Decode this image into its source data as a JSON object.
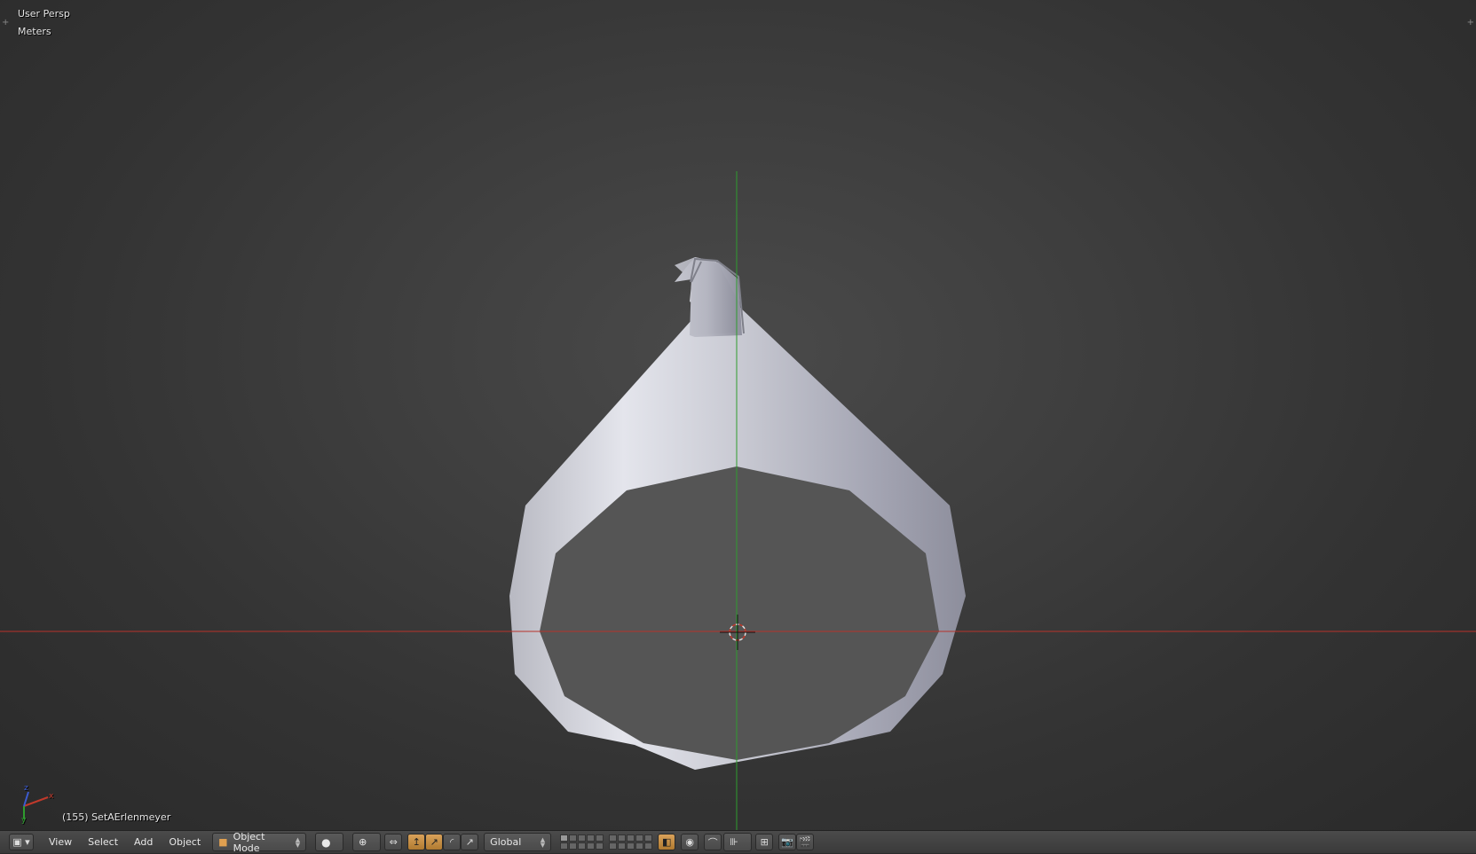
{
  "viewport": {
    "view_label": "User Persp",
    "units_label": "Meters",
    "object_info": "(155) SetAErlenmeyer"
  },
  "axes_gizmo": {
    "x": "x",
    "y": "y",
    "z": "z"
  },
  "header": {
    "menus": [
      "View",
      "Select",
      "Add",
      "Object"
    ],
    "mode": "Object Mode",
    "transform_orientation": "Global"
  },
  "colors": {
    "x_axis": "#c0392b",
    "y_axis": "#2e9c2e",
    "active_button": "#d9a25a",
    "object_surface": "#bfc0c8",
    "object_cap": "#555555"
  },
  "icons": [
    "editor-type-icon",
    "viewport-shading-icon",
    "pivot-icon",
    "manipulator-icon",
    "translate-icon",
    "rotate-icon",
    "scale-icon",
    "layer-grid",
    "lock-icon",
    "proportional-edit-icon",
    "snap-icon",
    "snap-element-icon",
    "render-icon",
    "render-anim-icon"
  ]
}
